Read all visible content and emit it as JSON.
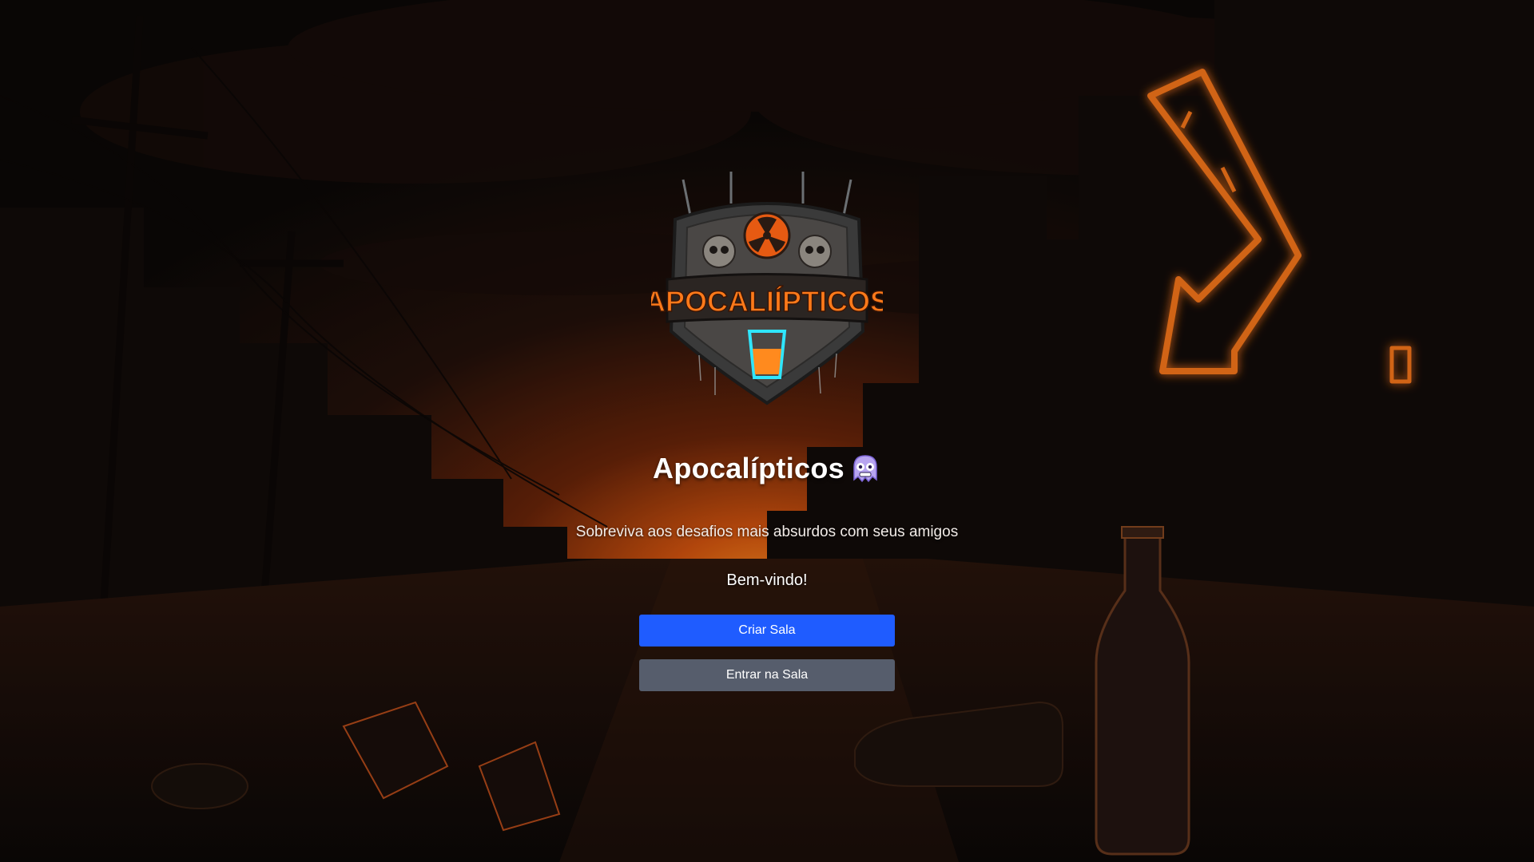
{
  "app": {
    "title": "Apocalípticos",
    "subtitle": "Sobreviva aos desafios mais absurdos com seus amigos",
    "welcome": "Bem-vindo!",
    "logo_text": "APOCALIÍPTICOS",
    "title_icon": "cold-face-emoji-icon"
  },
  "actions": {
    "create_room_label": "Criar Sala",
    "join_room_label": "Entrar na Sala"
  },
  "colors": {
    "primary_button": "#1f5cff",
    "secondary_button": "#565d6c",
    "neon_orange": "#ff7a1a",
    "neon_cyan": "#2fe6ff"
  }
}
